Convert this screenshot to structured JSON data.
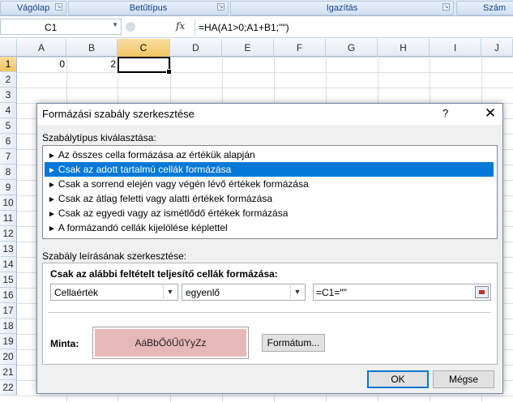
{
  "ribbon": {
    "groups": [
      {
        "label": "Vágólap"
      },
      {
        "label": "Betűtípus"
      },
      {
        "label": "Igazítás"
      },
      {
        "label": "Szám"
      }
    ]
  },
  "formula_bar": {
    "name_box": "C1",
    "fx_icon": "fx-icon",
    "formula": "=HA(A1>0;A1+B1;\"\")"
  },
  "grid": {
    "columns": [
      "A",
      "B",
      "C",
      "D",
      "E",
      "F",
      "G",
      "H",
      "I",
      "J"
    ],
    "rows": [
      "1",
      "2",
      "3",
      "4",
      "5",
      "6",
      "7",
      "8",
      "9",
      "10",
      "11",
      "12",
      "13",
      "14",
      "15",
      "16",
      "17",
      "18",
      "19",
      "20",
      "21",
      "22"
    ],
    "cells": {
      "A1": "0",
      "B1": "2",
      "C1": ""
    }
  },
  "dialog": {
    "title": "Formázási szabály szerkesztése",
    "help": "?",
    "close": "✕",
    "rule_type_label": "Szabálytípus kiválasztása:",
    "rule_types": [
      {
        "label": "Az összes cella formázása az értékük alapján"
      },
      {
        "label": "Csak az adott tartalmú cellák formázása"
      },
      {
        "label": "Csak a sorrend elején vagy végén lévő értékek formázása"
      },
      {
        "label": "Csak az átlag feletti vagy alatti értékek formázása"
      },
      {
        "label": "Csak az egyedi vagy az ismétlődő értékek formázása"
      },
      {
        "label": "A formázandó cellák kijelölése képlettel"
      }
    ],
    "selected_rule_index": 1,
    "arrow": "►",
    "description_label": "Szabály leírásának szerkesztése:",
    "condition_title": "Csak az alábbi feltételt teljesítő cellák formázása:",
    "field_select": "Cellaérték",
    "operator_select": "egyenlő",
    "value_input": "=C1=\"\"",
    "preview_label": "Minta:",
    "preview_text": "AáBbŐőŰűYyZz",
    "preview_fill": "#e6b8b7",
    "format_button": "Formátum...",
    "ok_button": "OK",
    "cancel_button": "Mégse"
  },
  "colors": {
    "selection": "#0078d7",
    "header_highlight": "#f2c464"
  }
}
